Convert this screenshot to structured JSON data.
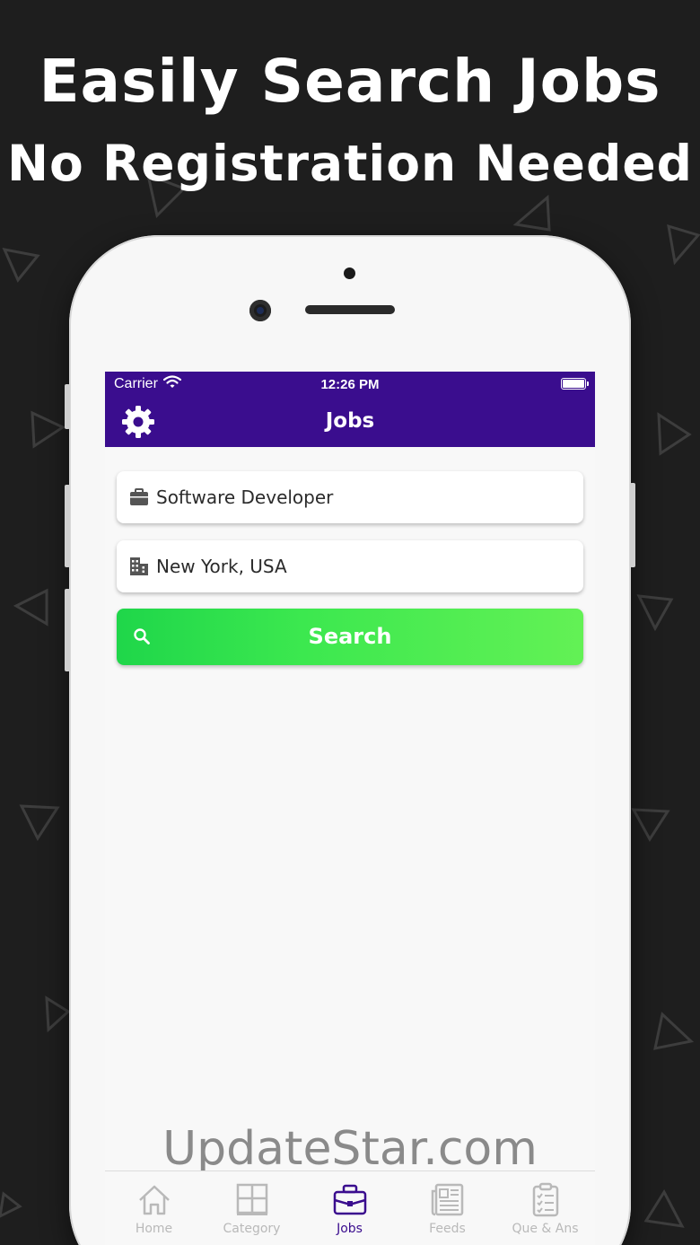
{
  "headline": {
    "line1": "Easily Search Jobs",
    "line2": "No Registration Needed"
  },
  "status_bar": {
    "carrier": "Carrier",
    "time": "12:26 PM"
  },
  "app_bar": {
    "title": "Jobs",
    "settings_icon": "gear-icon"
  },
  "search_form": {
    "job_field": {
      "value": "Software Developer",
      "icon": "briefcase-icon"
    },
    "location_field": {
      "value": "New York, USA",
      "icon": "building-icon"
    },
    "search_button": {
      "label": "Search",
      "icon": "search-icon"
    }
  },
  "watermark": "UpdateStar.com",
  "tab_bar": {
    "active": "Jobs",
    "items": [
      {
        "label": "Home",
        "icon": "home-icon"
      },
      {
        "label": "Category",
        "icon": "grid-icon"
      },
      {
        "label": "Jobs",
        "icon": "briefcase-icon"
      },
      {
        "label": "Feeds",
        "icon": "newspaper-icon"
      },
      {
        "label": "Que & Ans",
        "icon": "checklist-icon"
      }
    ]
  },
  "colors": {
    "background": "#1e1e1e",
    "app_bar": "#3a0d8e",
    "search_button_start": "#1fd64a",
    "search_button_end": "#63f155",
    "tab_active": "#3a0d8e",
    "tab_inactive": "#b9b9b9"
  }
}
